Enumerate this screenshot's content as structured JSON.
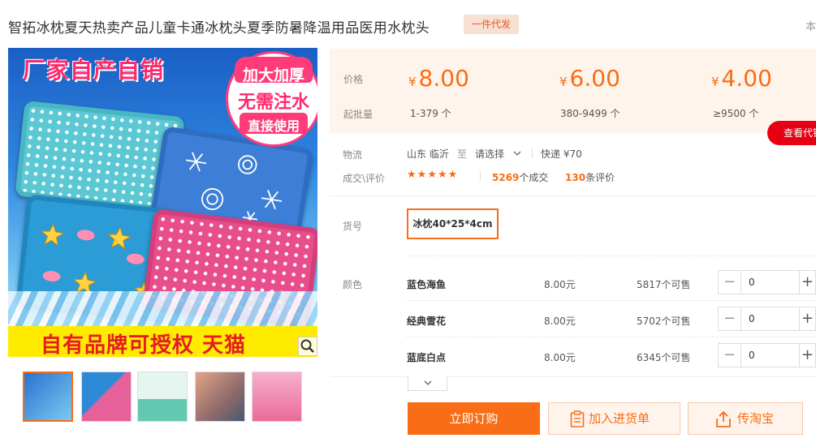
{
  "product": {
    "title": "智拓冰枕夏天热卖产品儿童卡通冰枕头夏季防暑降温用品医用水枕头",
    "badge": "一件代发",
    "corner_text": "本"
  },
  "gallery": {
    "banner_top": "厂家自产自销",
    "circle_line1": "加大加厚",
    "circle_line2": "无需注水",
    "circle_line3": "直接使用",
    "banner_bottom": "自有品牌可授权 天猫",
    "thumbnails": [
      "thumb-1",
      "thumb-2",
      "thumb-3",
      "thumb-4",
      "thumb-5"
    ]
  },
  "pricing": {
    "price_label": "价格",
    "moq_label": "起批量",
    "currency": "¥",
    "tiers": [
      {
        "price": "8.00",
        "qty": "1-379 个"
      },
      {
        "price": "6.00",
        "qty": "380-9499 个"
      },
      {
        "price": "4.00",
        "qty": "≥9500 个"
      }
    ],
    "view_button": "查看代销"
  },
  "logistics": {
    "label": "物流",
    "from": "山东 临沂",
    "to_word": "至",
    "to": "请选择",
    "express": "快递 ¥70"
  },
  "stats": {
    "label": "成交\\评价",
    "stars": "★★★★★",
    "deals_num": "5269",
    "deals_text": "个成交",
    "reviews_num": "130",
    "reviews_text": "条评价"
  },
  "sku": {
    "label": "货号",
    "selected": "冰枕40*25*4cm"
  },
  "colors": {
    "label": "颜色",
    "items": [
      {
        "name": "蓝色海鱼",
        "price": "8.00元",
        "stock": "5817个可售",
        "qty": "0"
      },
      {
        "name": "经典雪花",
        "price": "8.00元",
        "stock": "5702个可售",
        "qty": "0"
      },
      {
        "name": "蓝底白点",
        "price": "8.00元",
        "stock": "6345个可售",
        "qty": "0"
      }
    ]
  },
  "actions": {
    "order": "立即订购",
    "cart": "加入进货单",
    "share": "传淘宝"
  },
  "theme": {
    "accent": "#f86d15",
    "red": "#e60012",
    "price_bg": "#fff4ec"
  }
}
